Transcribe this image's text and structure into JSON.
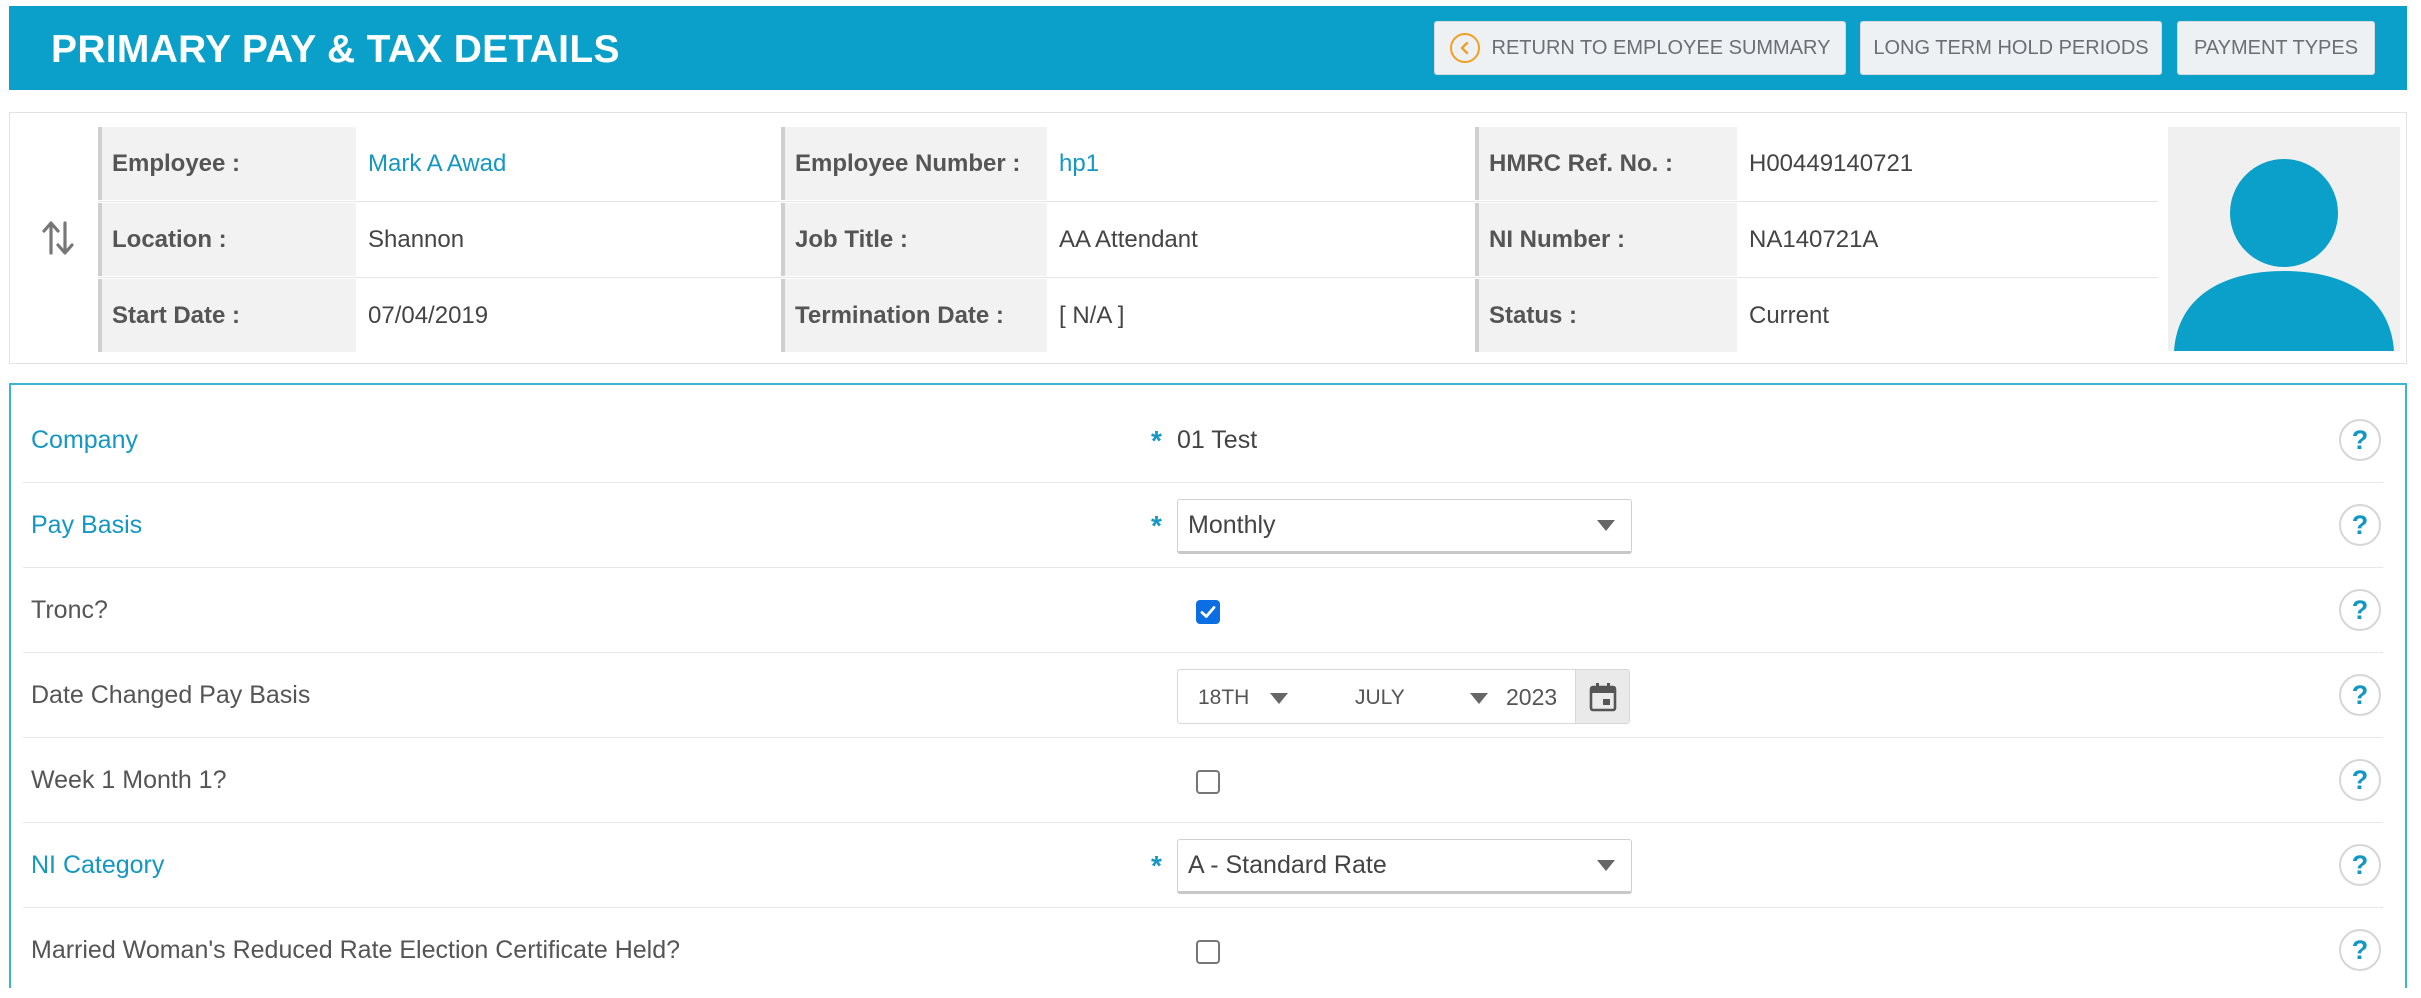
{
  "header": {
    "title": "PRIMARY PAY & TAX DETAILS",
    "buttons": {
      "return": "RETURN TO EMPLOYEE SUMMARY",
      "hold": "LONG TERM HOLD PERIODS",
      "payment_types": "PAYMENT TYPES"
    }
  },
  "employee": {
    "labels": {
      "employee": "Employee :",
      "employee_number": "Employee Number :",
      "hmrc_ref": "HMRC Ref. No. :",
      "location": "Location :",
      "job_title": "Job Title :",
      "ni_number": "NI Number :",
      "start_date": "Start Date :",
      "termination_date": "Termination Date :",
      "status": "Status :"
    },
    "values": {
      "employee": "Mark A Awad",
      "employee_number": "hp1",
      "hmrc_ref": "H00449140721",
      "location": "Shannon",
      "job_title": "AA Attendant",
      "ni_number": "NA140721A",
      "start_date": "07/04/2019",
      "termination_date": "[ N/A ]",
      "status": "Current"
    }
  },
  "form": {
    "required_marker": "*",
    "help_glyph": "?",
    "company": {
      "label": "Company",
      "value": "01 Test"
    },
    "pay_basis": {
      "label": "Pay Basis",
      "value": "Monthly"
    },
    "tronc": {
      "label": "Tronc?",
      "checked": true
    },
    "date_changed": {
      "label": "Date Changed Pay Basis",
      "day": "18TH",
      "month": "JULY",
      "year": "2023"
    },
    "week1": {
      "label": "Week 1 Month 1?",
      "checked": false
    },
    "ni_category": {
      "label": "NI Category",
      "value": "A - Standard Rate"
    },
    "married_woman": {
      "label": "Married Woman's Reduced Rate Election Certificate Held?",
      "checked": false
    }
  },
  "colors": {
    "brand": "#0aa0c9",
    "link": "#1497c3",
    "return_icon": "#f0a020",
    "checkbox_checked": "#0b6ee3"
  },
  "icons": {
    "return": "chevron-left-circle-icon",
    "swap": "swap-vertical-icon",
    "avatar": "user-silhouette-icon",
    "calendar": "calendar-icon",
    "help": "help-icon"
  }
}
